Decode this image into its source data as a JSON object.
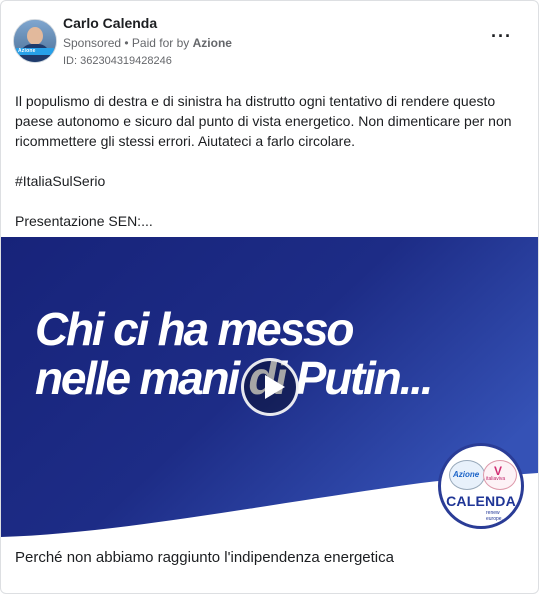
{
  "post": {
    "author": "Carlo Calenda",
    "sponsored": "Sponsored",
    "paid_for_prefix": "• Paid for by",
    "paid_for_by": "Azione",
    "ad_id": "ID: 362304319428246",
    "more_icon": "more-horizontal-icon"
  },
  "avatar": {
    "band_text": "Azione"
  },
  "body": {
    "paragraph1": "Il populismo di destra e di sinistra ha distrutto ogni tentativo di rendere questo paese autonomo e sicuro dal punto di vista energetico. Non dimenticare per non ricommettere gli stessi errori. Aiutateci a farlo circolare.",
    "hashtag": "#ItaliaSulSerio",
    "paragraph3": "Presentazione SEN:..."
  },
  "media": {
    "headline_line1": "Chi ci ha messo",
    "headline_line2": "nelle mani di Putin...",
    "play_icon": "play-icon",
    "logo": {
      "azione": "Azione",
      "italia_viva": "italiaviva",
      "name": "CALENDA",
      "sub_line1": "renew",
      "sub_line2": "europe."
    },
    "colors": {
      "background_dark": "#1b2a80",
      "background_light": "#2f4fb0",
      "logo_blue": "#1f3596"
    }
  },
  "caption": "Perché non abbiamo raggiunto l'indipendenza energetica"
}
